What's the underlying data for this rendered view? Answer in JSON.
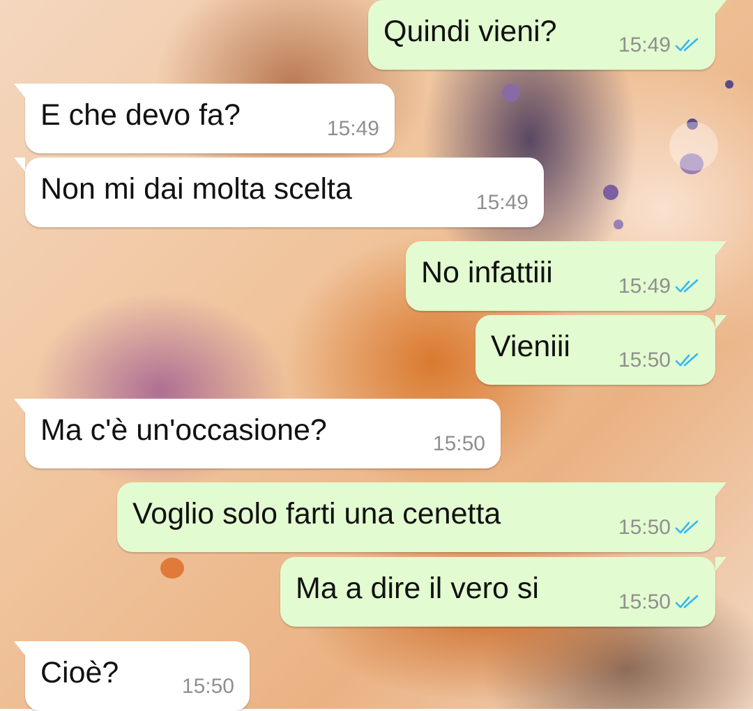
{
  "chat": {
    "messages": [
      {
        "direction": "out",
        "text": "Quindi vieni?",
        "time": "15:49",
        "status": "read"
      },
      {
        "direction": "in",
        "text": "E che devo fa?",
        "time": "15:49"
      },
      {
        "direction": "in",
        "text": "Non mi dai molta scelta",
        "time": "15:49"
      },
      {
        "direction": "out",
        "text": "No infattiii",
        "time": "15:49",
        "status": "read"
      },
      {
        "direction": "out",
        "text": "Vieniii",
        "time": "15:50",
        "status": "read"
      },
      {
        "direction": "in",
        "text": "Ma c'è un'occasione?",
        "time": "15:50"
      },
      {
        "direction": "out",
        "text": "Voglio solo farti una cenetta",
        "time": "15:50",
        "status": "read"
      },
      {
        "direction": "out",
        "text": "Ma a dire il vero si",
        "time": "15:50",
        "status": "read"
      },
      {
        "direction": "in",
        "text": "Cioè?",
        "time": "15:50"
      }
    ]
  },
  "icons": {
    "read_receipt": "double-check-icon"
  },
  "colors": {
    "incoming_bubble": "#ffffff",
    "outgoing_bubble": "#e2fbd0",
    "read_tick": "#34b7f1",
    "timestamp": "#8f8f8f"
  }
}
